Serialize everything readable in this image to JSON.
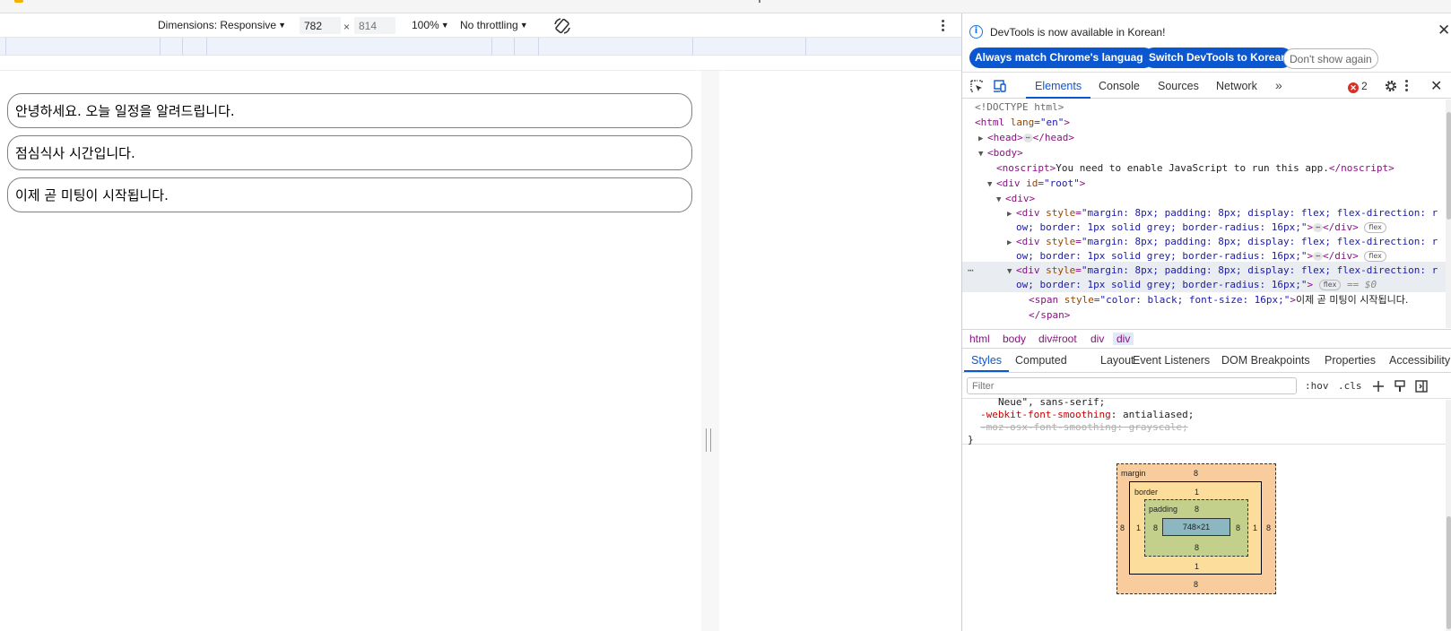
{
  "toolbar": {
    "dimensions_label": "Dimensions: Responsive",
    "width": "782",
    "height_placeholder": "814",
    "times": "×",
    "zoom": "100%",
    "throttling": "No throttling",
    "rotate_icon": "rotate-icon",
    "more_icon": "kebab-icon"
  },
  "page": {
    "messages": [
      "안녕하세요. 오늘 일정을 알려드립니다.",
      "점심식사 시간입니다.",
      "이제 곧 미팅이 시작됩니다."
    ]
  },
  "devtools": {
    "infobar": {
      "text": "DevTools is now available in Korean!",
      "btn_match": "Always match Chrome's language",
      "btn_switch": "Switch DevTools to Korean",
      "btn_dismiss": "Don't show again",
      "close": "✕"
    },
    "tabs": [
      "Elements",
      "Console",
      "Sources",
      "Network"
    ],
    "more_tabs": "»",
    "error_count": "2",
    "close": "✕",
    "tree": {
      "doctype": "<!DOCTYPE html>",
      "html_open": "<html ",
      "html_lang_attr": "lang",
      "html_lang_val": "\"en\"",
      "head": "<head>",
      "head_close": "</head>",
      "body": "<body>",
      "noscript_open": "<noscript>",
      "noscript_text": "You need to enable JavaScript to run this app.",
      "noscript_close": "</noscript>",
      "root_open": "<div ",
      "root_attr": "id",
      "root_val": "\"root\"",
      "div_open": "<div>",
      "style_attr": "style",
      "style_val_1": "\"margin: 8px; padding: 8px; display: flex; flex-direction: r",
      "style_val_2": "ow; border: 1px solid grey; border-radius: 16px;\"",
      "div_close": "</div>",
      "flex_badge": "flex",
      "eq_dollar": "== $0",
      "span_open": "<span ",
      "span_style_val": "\"color: black; font-size: 16px;\"",
      "span_text": "이제 곧 미팅이 시작됩니다.",
      "span_close": "</span>",
      "ellipsis": "⋯"
    },
    "breadcrumbs": [
      "html",
      "body",
      "div#root",
      "div",
      "div"
    ],
    "subtabs": [
      "Styles",
      "Computed",
      "Layout",
      "Event Listeners",
      "DOM Breakpoints",
      "Properties",
      "Accessibility"
    ],
    "filter_placeholder": "Filter",
    "hov": ":hov",
    "cls": ".cls",
    "css": {
      "line1": "Neue\", sans-serif;",
      "prop2": "-webkit-font-smoothing",
      "val2": "antialiased;",
      "prop3": "-moz-osx-font-smoothing",
      "val3": "grayscale;",
      "close": "}"
    },
    "boxmodel": {
      "margin_label": "margin",
      "border_label": "border",
      "padding_label": "padding",
      "margin": "8",
      "border": "1",
      "padding": "8",
      "content": "748×21"
    }
  },
  "colors": {
    "accent": "#0b57d0",
    "error": "#d93025",
    "tag": "#881280",
    "attr": "#994500",
    "value": "#1a1aa6"
  }
}
